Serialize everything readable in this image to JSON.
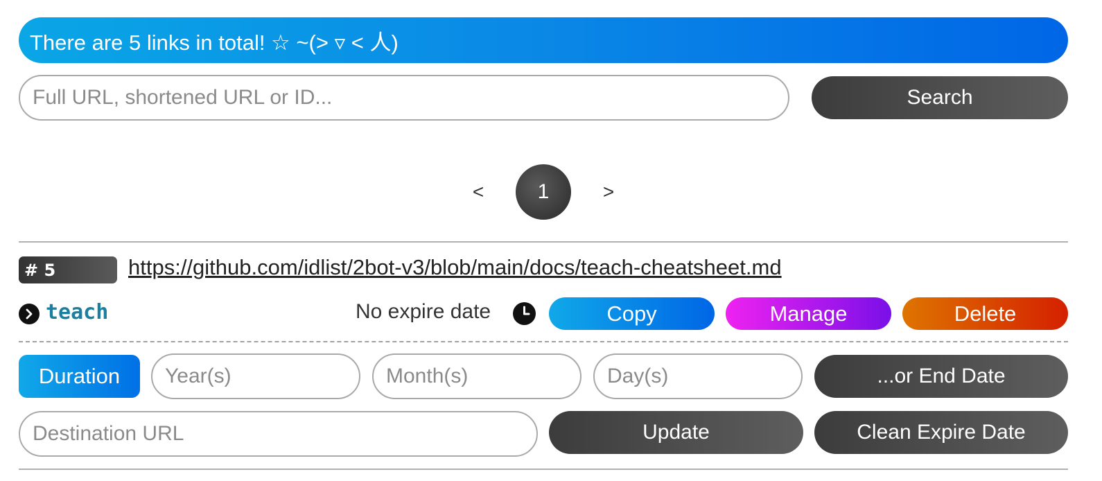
{
  "banner": {
    "text": "There are 5 links in total! ☆ ~(> ▿ < 人)"
  },
  "search": {
    "placeholder": "Full URL, shortened URL or ID...",
    "button": "Search"
  },
  "pagination": {
    "prev": "<",
    "current": "1",
    "next": ">"
  },
  "link_entry": {
    "id_label": "# 5",
    "url": "https://github.com/idlist/2bot-v3/blob/main/docs/teach-cheatsheet.md",
    "short_code": "teach",
    "expire_status": "No expire date",
    "actions": {
      "copy": "Copy",
      "manage": "Manage",
      "delete": "Delete"
    }
  },
  "manage_panel": {
    "duration_label": "Duration",
    "years_placeholder": "Year(s)",
    "months_placeholder": "Month(s)",
    "days_placeholder": "Day(s)",
    "end_date_button": "...or End Date",
    "destination_placeholder": "Destination URL",
    "update_button": "Update",
    "clean_expire_button": "Clean Expire Date"
  },
  "colors": {
    "banner_start": "#0aa6e6",
    "banner_end": "#0066e6",
    "manage_start": "#ee22f0",
    "manage_end": "#7a10e8",
    "delete_start": "#de7400",
    "delete_end": "#d42000",
    "short_code": "#1d7f9f",
    "dark_button": "#3c3c3c"
  },
  "icons": {
    "short_link": "chevron-right-circle-icon",
    "expire": "clock-icon"
  }
}
